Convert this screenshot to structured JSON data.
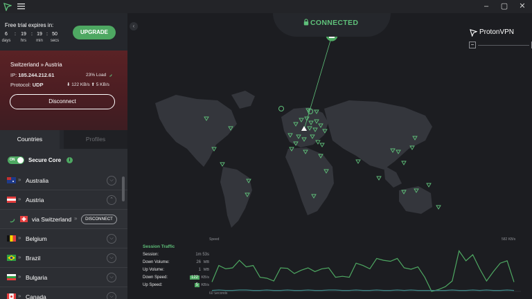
{
  "app": {
    "brand": "ProtonVPN",
    "status": "CONNECTED",
    "window_controls": [
      "–",
      "▢",
      "✕"
    ]
  },
  "trial": {
    "title": "Free trial expires in:",
    "countdown": [
      {
        "value": "6",
        "unit": "days"
      },
      {
        "value": "19",
        "unit": "hrs"
      },
      {
        "value": "19",
        "unit": "min"
      },
      {
        "value": "50",
        "unit": "secs"
      }
    ],
    "upgrade_label": "UPGRADE"
  },
  "connection": {
    "route": "Switzerland » Austria",
    "ip_label": "IP:",
    "ip_value": "185.244.212.61",
    "load": "23% Load",
    "protocol_label": "Protocol:",
    "protocol_value": "UDP",
    "down": "122 KB/s",
    "up": "5 KB/s",
    "disconnect_label": "Disconnect"
  },
  "tabs": [
    "Countries",
    "Profiles"
  ],
  "secure_core": {
    "toggle": "ON",
    "label": "Secure Core"
  },
  "countries": [
    {
      "name": "Australia",
      "flag": "au"
    },
    {
      "name": "Austria",
      "flag": "at",
      "expanded": true
    },
    {
      "name": "via Switzerland",
      "flag": "ch",
      "sub": true,
      "action": "DISCONNECT"
    },
    {
      "name": "Belgium",
      "flag": "be"
    },
    {
      "name": "Brazil",
      "flag": "br"
    },
    {
      "name": "Bulgaria",
      "flag": "bg"
    },
    {
      "name": "Canada",
      "flag": "ca"
    }
  ],
  "traffic": {
    "title": "Session Traffic",
    "rows": [
      {
        "label": "Session:",
        "value": "1m 53s",
        "unit": ""
      },
      {
        "label": "Down Volume:",
        "value": "26",
        "unit": "MB"
      },
      {
        "label": "Up Volume:",
        "value": "1",
        "unit": "MB"
      },
      {
        "label": "Down Speed:",
        "value": "122",
        "unit": "KB/s",
        "highlight": true
      },
      {
        "label": "Up Speed:",
        "value": "5",
        "unit": "KB/s",
        "highlight": true
      }
    ],
    "graph_top_left": "Speed",
    "graph_top_right": "582 KB/s",
    "graph_bottom_left": "60 Seconds"
  },
  "chart_data": {
    "type": "line",
    "series": [
      {
        "values": [
          20,
          55,
          48,
          50,
          66,
          52,
          55,
          30,
          28,
          22,
          50,
          49,
          38,
          45,
          50,
          42,
          48,
          50,
          30,
          32,
          30,
          60,
          55,
          48,
          70,
          66,
          64,
          70,
          50,
          47,
          52,
          30,
          0,
          4,
          10,
          22,
          86,
          65,
          78,
          48,
          22,
          42,
          60,
          65,
          20
        ]
      },
      {
        "values": [
          2,
          3,
          2,
          2,
          3,
          3,
          2,
          2,
          3,
          2,
          2,
          3,
          2,
          2,
          3,
          2,
          2,
          3,
          3,
          2,
          2,
          3,
          2,
          2,
          3,
          2,
          2,
          3,
          2,
          3,
          2,
          2,
          2,
          2,
          2,
          3,
          2,
          2,
          3,
          2,
          3,
          2,
          2,
          3,
          2
        ]
      }
    ]
  },
  "colors": {
    "accent": "#4ea862",
    "status": "#5fc07a",
    "danger_panel": "#5a2225"
  }
}
